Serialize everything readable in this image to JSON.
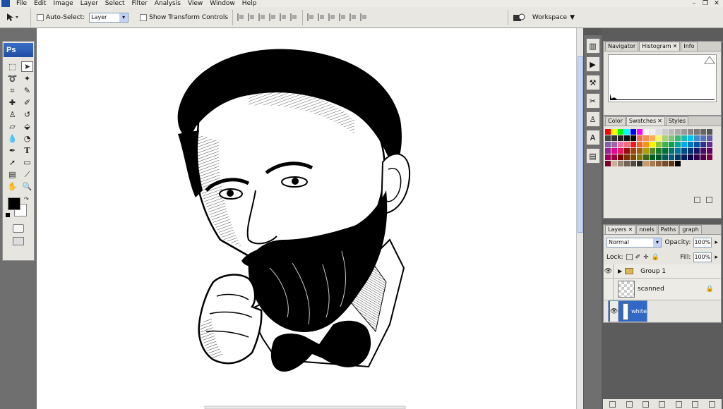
{
  "menu": [
    "File",
    "Edit",
    "Image",
    "Layer",
    "Select",
    "Filter",
    "Analysis",
    "View",
    "Window",
    "Help"
  ],
  "options": {
    "auto_select_label": "Auto-Select:",
    "auto_select_value": "Layer",
    "show_transform_label": "Show Transform Controls",
    "workspace_label": "Workspace"
  },
  "toolbox": {
    "logo": "Ps"
  },
  "panels": {
    "group1_tabs": [
      "Navigator",
      "Histogram",
      "Info"
    ],
    "group2_tabs": [
      "Color",
      "Swatches",
      "Styles"
    ],
    "layers_tabs": [
      "Layers",
      "nnels",
      "Paths",
      "graph"
    ],
    "blend_mode": "Normal",
    "opacity_label": "Opacity:",
    "opacity_value": "100%",
    "lock_label": "Lock:",
    "fill_label": "Fill:",
    "fill_value": "100%",
    "layers": [
      {
        "name": "Group 1"
      },
      {
        "name": "scanned"
      },
      {
        "name": "white"
      }
    ]
  },
  "colors": {
    "selection": "#3168c6",
    "swatches": [
      "#ff0000",
      "#ffff00",
      "#00ff00",
      "#00ffff",
      "#0000ff",
      "#ff00ff",
      "#ffffff",
      "#eeeeee",
      "#dddddd",
      "#cccccc",
      "#bbbbbb",
      "#aaaaaa",
      "#999999",
      "#888888",
      "#777777",
      "#666666",
      "#555555",
      "#444444",
      "#333333",
      "#222222",
      "#111111",
      "#000000",
      "#f26c4f",
      "#f68e56",
      "#fbaf5d",
      "#fff568",
      "#acd373",
      "#7cc576",
      "#3bb878",
      "#1abbb4",
      "#00bff3",
      "#438ccb",
      "#5674b9",
      "#605ca8",
      "#855fa8",
      "#a763a8",
      "#f06ea9",
      "#f26d7d",
      "#ed1c24",
      "#f26522",
      "#f7941d",
      "#fff200",
      "#8dc63f",
      "#39b54a",
      "#00a651",
      "#00a99d",
      "#00aeef",
      "#0072bc",
      "#0054a6",
      "#2e3192",
      "#662d91",
      "#92278f",
      "#ec008c",
      "#ed145b",
      "#9e0b0f",
      "#a0410d",
      "#a36209",
      "#aba000",
      "#598527",
      "#197b30",
      "#007236",
      "#00746b",
      "#0076a3",
      "#004b80",
      "#003471",
      "#1b1464",
      "#440e62",
      "#630460",
      "#9e005d",
      "#9e0039",
      "#790000",
      "#7b2e00",
      "#7d4900",
      "#827b00",
      "#406618",
      "#005e20",
      "#005826",
      "#005952",
      "#005b7f",
      "#003663",
      "#002157",
      "#0d004c",
      "#32004b",
      "#4b0049",
      "#7b0046",
      "#7a0026",
      "#c7b299",
      "#998675",
      "#736357",
      "#534741",
      "#37302a",
      "#c69c6d",
      "#a67c52",
      "#8c6239",
      "#754c24",
      "#603913",
      "#000000"
    ]
  }
}
